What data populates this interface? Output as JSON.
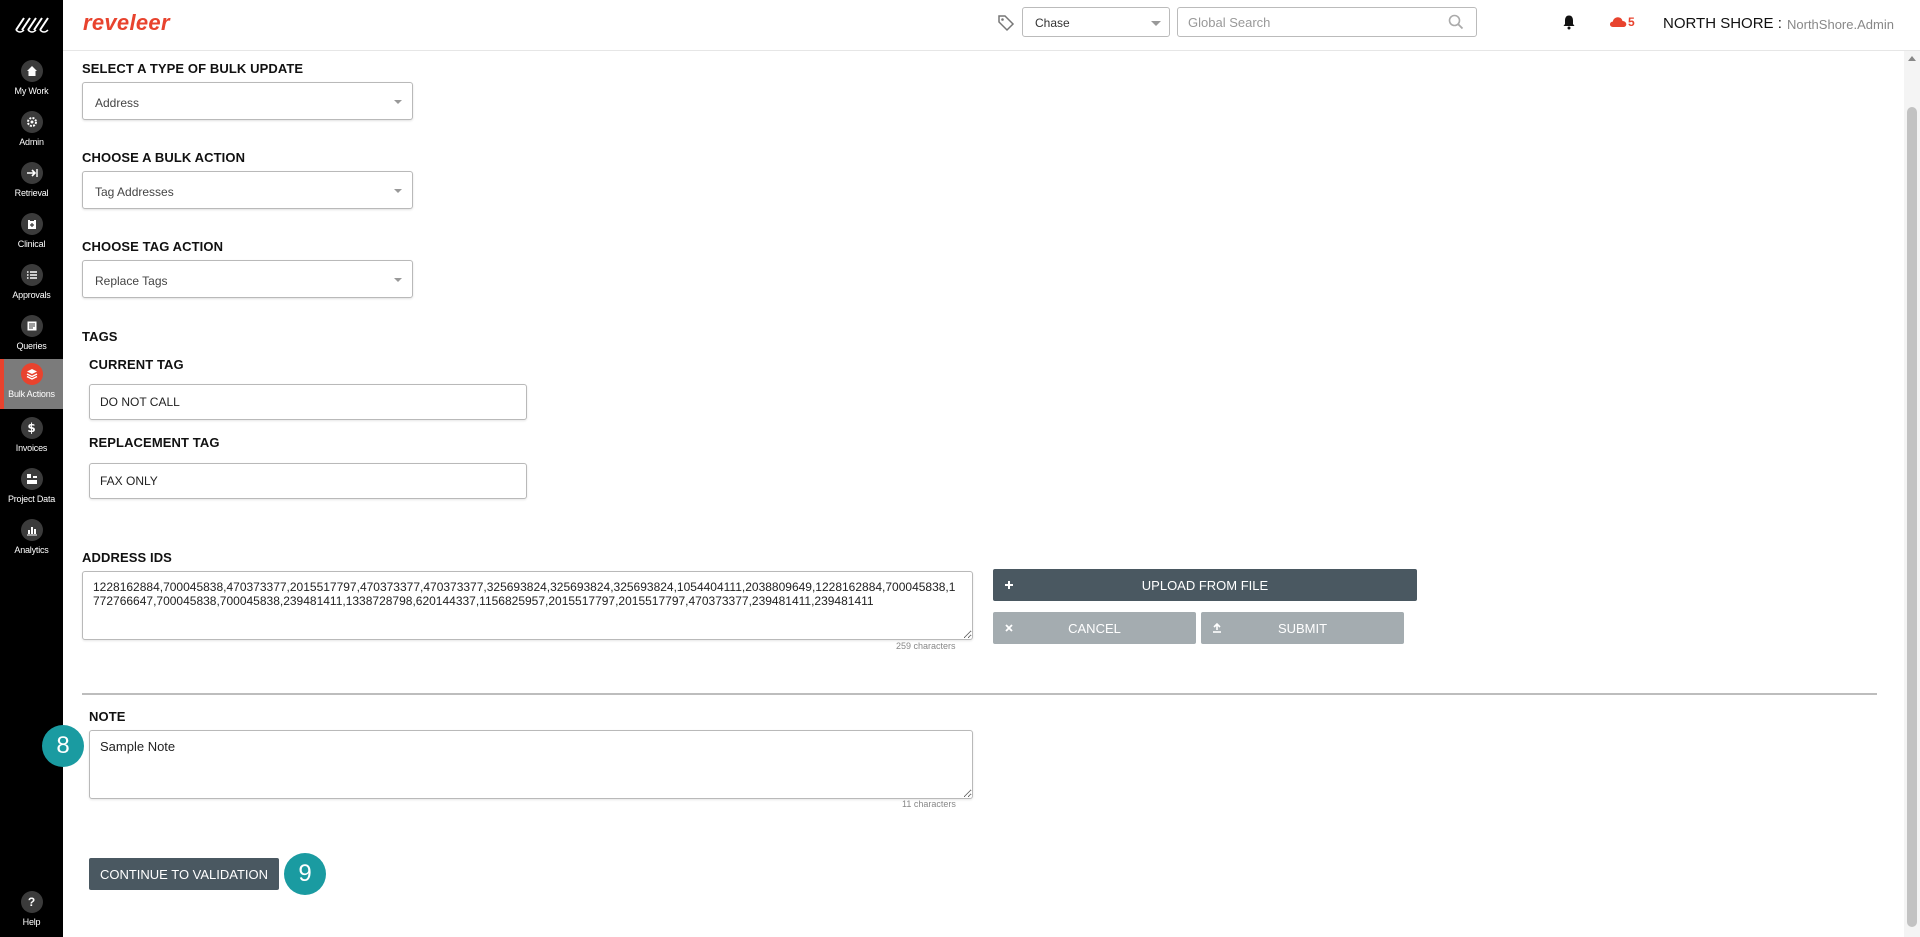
{
  "sidebar": {
    "items": [
      {
        "label": "My Work",
        "icon": "home-icon"
      },
      {
        "label": "Admin",
        "icon": "gear-icon"
      },
      {
        "label": "Retrieval",
        "icon": "arrow-right-icon"
      },
      {
        "label": "Clinical",
        "icon": "clipboard-icon"
      },
      {
        "label": "Approvals",
        "icon": "list-check-icon"
      },
      {
        "label": "Queries",
        "icon": "document-icon"
      },
      {
        "label": "Bulk Actions",
        "icon": "layers-icon",
        "active": true
      },
      {
        "label": "Invoices",
        "icon": "dollar-icon"
      },
      {
        "label": "Project Data",
        "icon": "grid-icon"
      },
      {
        "label": "Analytics",
        "icon": "bar-chart-icon"
      }
    ],
    "help_label": "Help"
  },
  "header": {
    "brand": "reveleer",
    "entity_select": "Chase",
    "search_placeholder": "Global Search",
    "notification_count": "5",
    "org": "NORTH SHORE :",
    "user": "NorthShore.Admin"
  },
  "form": {
    "bulk_type_label": "SELECT A TYPE OF BULK UPDATE",
    "bulk_type_value": "Address",
    "bulk_action_label": "CHOOSE A BULK ACTION",
    "bulk_action_value": "Tag Addresses",
    "tag_action_label": "CHOOSE TAG ACTION",
    "tag_action_value": "Replace Tags",
    "tags_label": "TAGS",
    "current_tag_label": "CURRENT TAG",
    "current_tag_value": "DO NOT CALL",
    "replacement_tag_label": "REPLACEMENT TAG",
    "replacement_tag_value": "FAX ONLY",
    "address_ids_label": "ADDRESS IDS",
    "address_ids_value": "1228162884,700045838,470373377,2015517797,470373377,470373377,325693824,325693824,325693824,1054404111,2038809649,1228162884,700045838,1772766647,700045838,700045838,239481411,1338728798,620144337,1156825957,2015517797,2015517797,470373377,239481411,239481411",
    "address_ids_count": "259 characters",
    "upload_label": "UPLOAD FROM FILE",
    "cancel_label": "CANCEL",
    "submit_label": "SUBMIT",
    "note_label": "NOTE",
    "note_value": "Sample Note",
    "note_count": "11 characters",
    "continue_label": "CONTINUE TO VALIDATION"
  },
  "annotations": {
    "badge_note": "8",
    "badge_continue": "9"
  },
  "colors": {
    "brand": "#e8432e",
    "dark_button": "#4a5861",
    "grey_button": "#a4acb0",
    "badge": "#1a9ba1"
  }
}
